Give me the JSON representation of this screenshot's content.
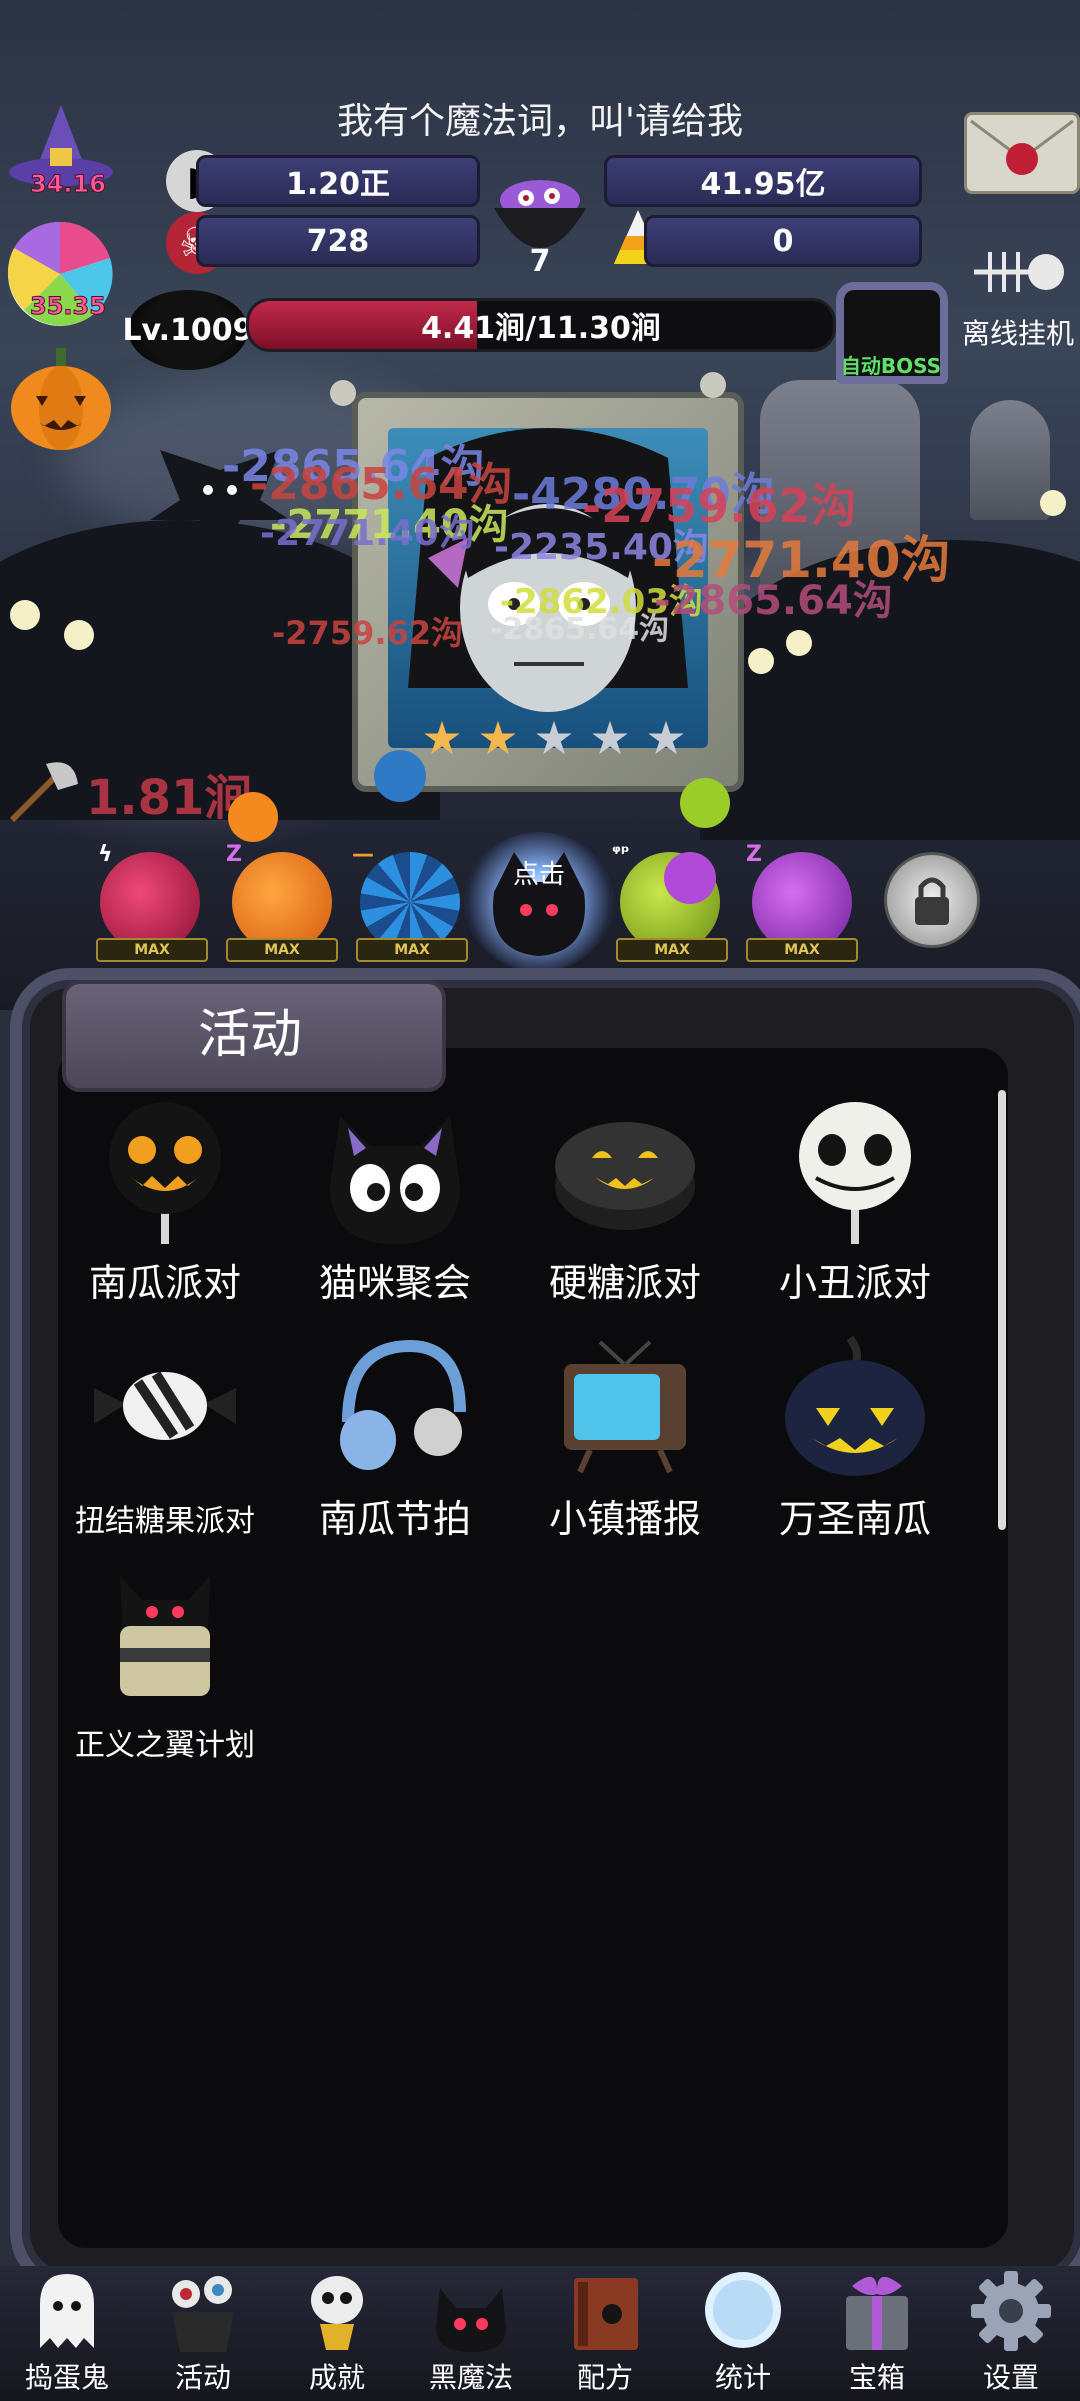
{
  "header": {
    "banner_text": "我有个魔法词，叫'请给我",
    "resources": {
      "coins": "1.20正",
      "skull_potion": "41.95亿",
      "candy_bow": "728",
      "candy_corn": "0",
      "cauldron": "7"
    },
    "side_values": {
      "witch": "34.16",
      "lollipop": "35.35"
    },
    "level": "Lv.1009",
    "hp": {
      "text": "4.41涧/11.30涧",
      "fraction": 0.39
    },
    "auto_boss": "自动BOSS",
    "offline": "离线挂机"
  },
  "battle": {
    "stars_filled": 2,
    "stars_total": 5,
    "damage_numbers": [
      {
        "text": "-2865.64沟",
        "color": "#7b87e8"
      },
      {
        "text": "-2865.64沟",
        "color": "#c9433f"
      },
      {
        "text": "-2771.40沟",
        "color": "#c9e85a"
      },
      {
        "text": "-4280.70沟",
        "color": "#6d7cd8"
      },
      {
        "text": "-2759.62沟",
        "color": "#d64257"
      },
      {
        "text": "-2771.40沟",
        "color": "#7a6fd0"
      },
      {
        "text": "-2235.40沟",
        "color": "#8b86e0"
      },
      {
        "text": "-2771.40沟",
        "color": "#e57a3c"
      },
      {
        "text": "-2862.03沟",
        "color": "#d2dd3a"
      },
      {
        "text": "-2865.64沟",
        "color": "#e0e0e0"
      },
      {
        "text": "-2865.64沟",
        "color": "#b34d7a"
      },
      {
        "text": "-2759.62沟",
        "color": "#c9433f"
      }
    ],
    "axe_damage": "1.81涧",
    "click_label": "点击",
    "slots": [
      {
        "mark": "ϟ",
        "max": "MAX"
      },
      {
        "mark": "Z",
        "max": "MAX"
      },
      {
        "mark": "—",
        "max": "MAX"
      },
      {
        "mark": "",
        "max": ""
      },
      {
        "mark": "ᵠᵖ",
        "max": "MAX"
      },
      {
        "mark": "Z",
        "max": "MAX"
      }
    ]
  },
  "panel": {
    "title": "活动",
    "activities": [
      {
        "label": "南瓜派对",
        "icon": "pumpkin-lollipop-icon"
      },
      {
        "label": "猫咪聚会",
        "icon": "black-cat-icon"
      },
      {
        "label": "硬糖派对",
        "icon": "hard-candy-icon"
      },
      {
        "label": "小丑派对",
        "icon": "skull-lollipop-icon"
      },
      {
        "label": "扭结糖果派对",
        "icon": "twist-candy-icon"
      },
      {
        "label": "南瓜节拍",
        "icon": "headphones-icon"
      },
      {
        "label": "小镇播报",
        "icon": "tv-icon"
      },
      {
        "label": "万圣南瓜",
        "icon": "dark-pumpkin-icon"
      },
      {
        "label": "正义之翼计划",
        "icon": "winged-cake-icon"
      }
    ]
  },
  "nav": [
    {
      "label": "捣蛋鬼",
      "icon": "ghost-icon"
    },
    {
      "label": "活动",
      "icon": "cupcake-eyes-icon"
    },
    {
      "label": "成就",
      "icon": "skull-trophy-icon"
    },
    {
      "label": "黑魔法",
      "icon": "demon-icon"
    },
    {
      "label": "配方",
      "icon": "spellbook-icon"
    },
    {
      "label": "统计",
      "icon": "crystal-ball-icon"
    },
    {
      "label": "宝箱",
      "icon": "gift-box-icon"
    },
    {
      "label": "设置",
      "icon": "gear-icon"
    }
  ]
}
